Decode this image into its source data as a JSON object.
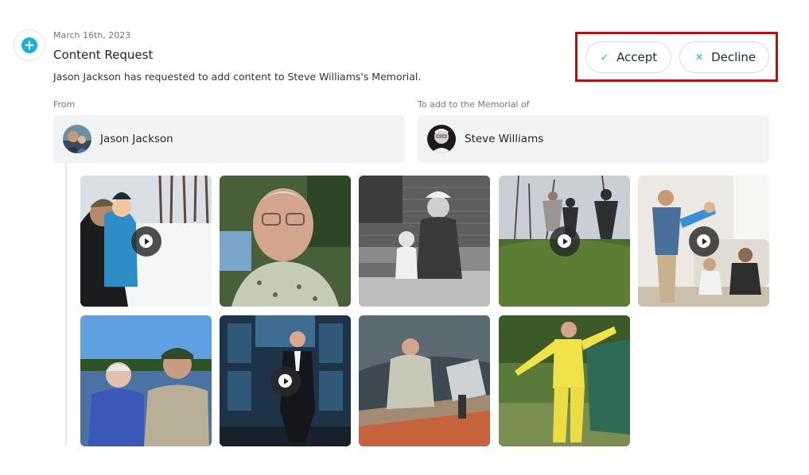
{
  "request": {
    "date": "March 16th, 2023",
    "title": "Content Request",
    "description": "Jason Jackson has requested to add content to Steve Williams's Memorial."
  },
  "actions": {
    "accept_label": "Accept",
    "decline_label": "Decline",
    "highlight_color": "#b11212",
    "accent_color": "#19b3d3"
  },
  "from": {
    "label": "From",
    "name": "Jason Jackson"
  },
  "to": {
    "label": "To add to the Memorial of",
    "name": "Steve Williams"
  },
  "media": [
    {
      "type": "video",
      "subject": "man holding child in winter snow"
    },
    {
      "type": "photo",
      "subject": "elderly man with glasses in patterned shirt"
    },
    {
      "type": "photo",
      "subject": "black and white photo of man sitting with child"
    },
    {
      "type": "video",
      "subject": "people playing outdoors on grass"
    },
    {
      "type": "video",
      "subject": "family playing in living room"
    },
    {
      "type": "photo",
      "subject": "elderly couple on boat in life vests"
    },
    {
      "type": "video",
      "subject": "man in suit on stage"
    },
    {
      "type": "photo",
      "subject": "man sitting in boat on lake"
    },
    {
      "type": "photo",
      "subject": "man in yellow raincoat dancing at campsite"
    }
  ]
}
